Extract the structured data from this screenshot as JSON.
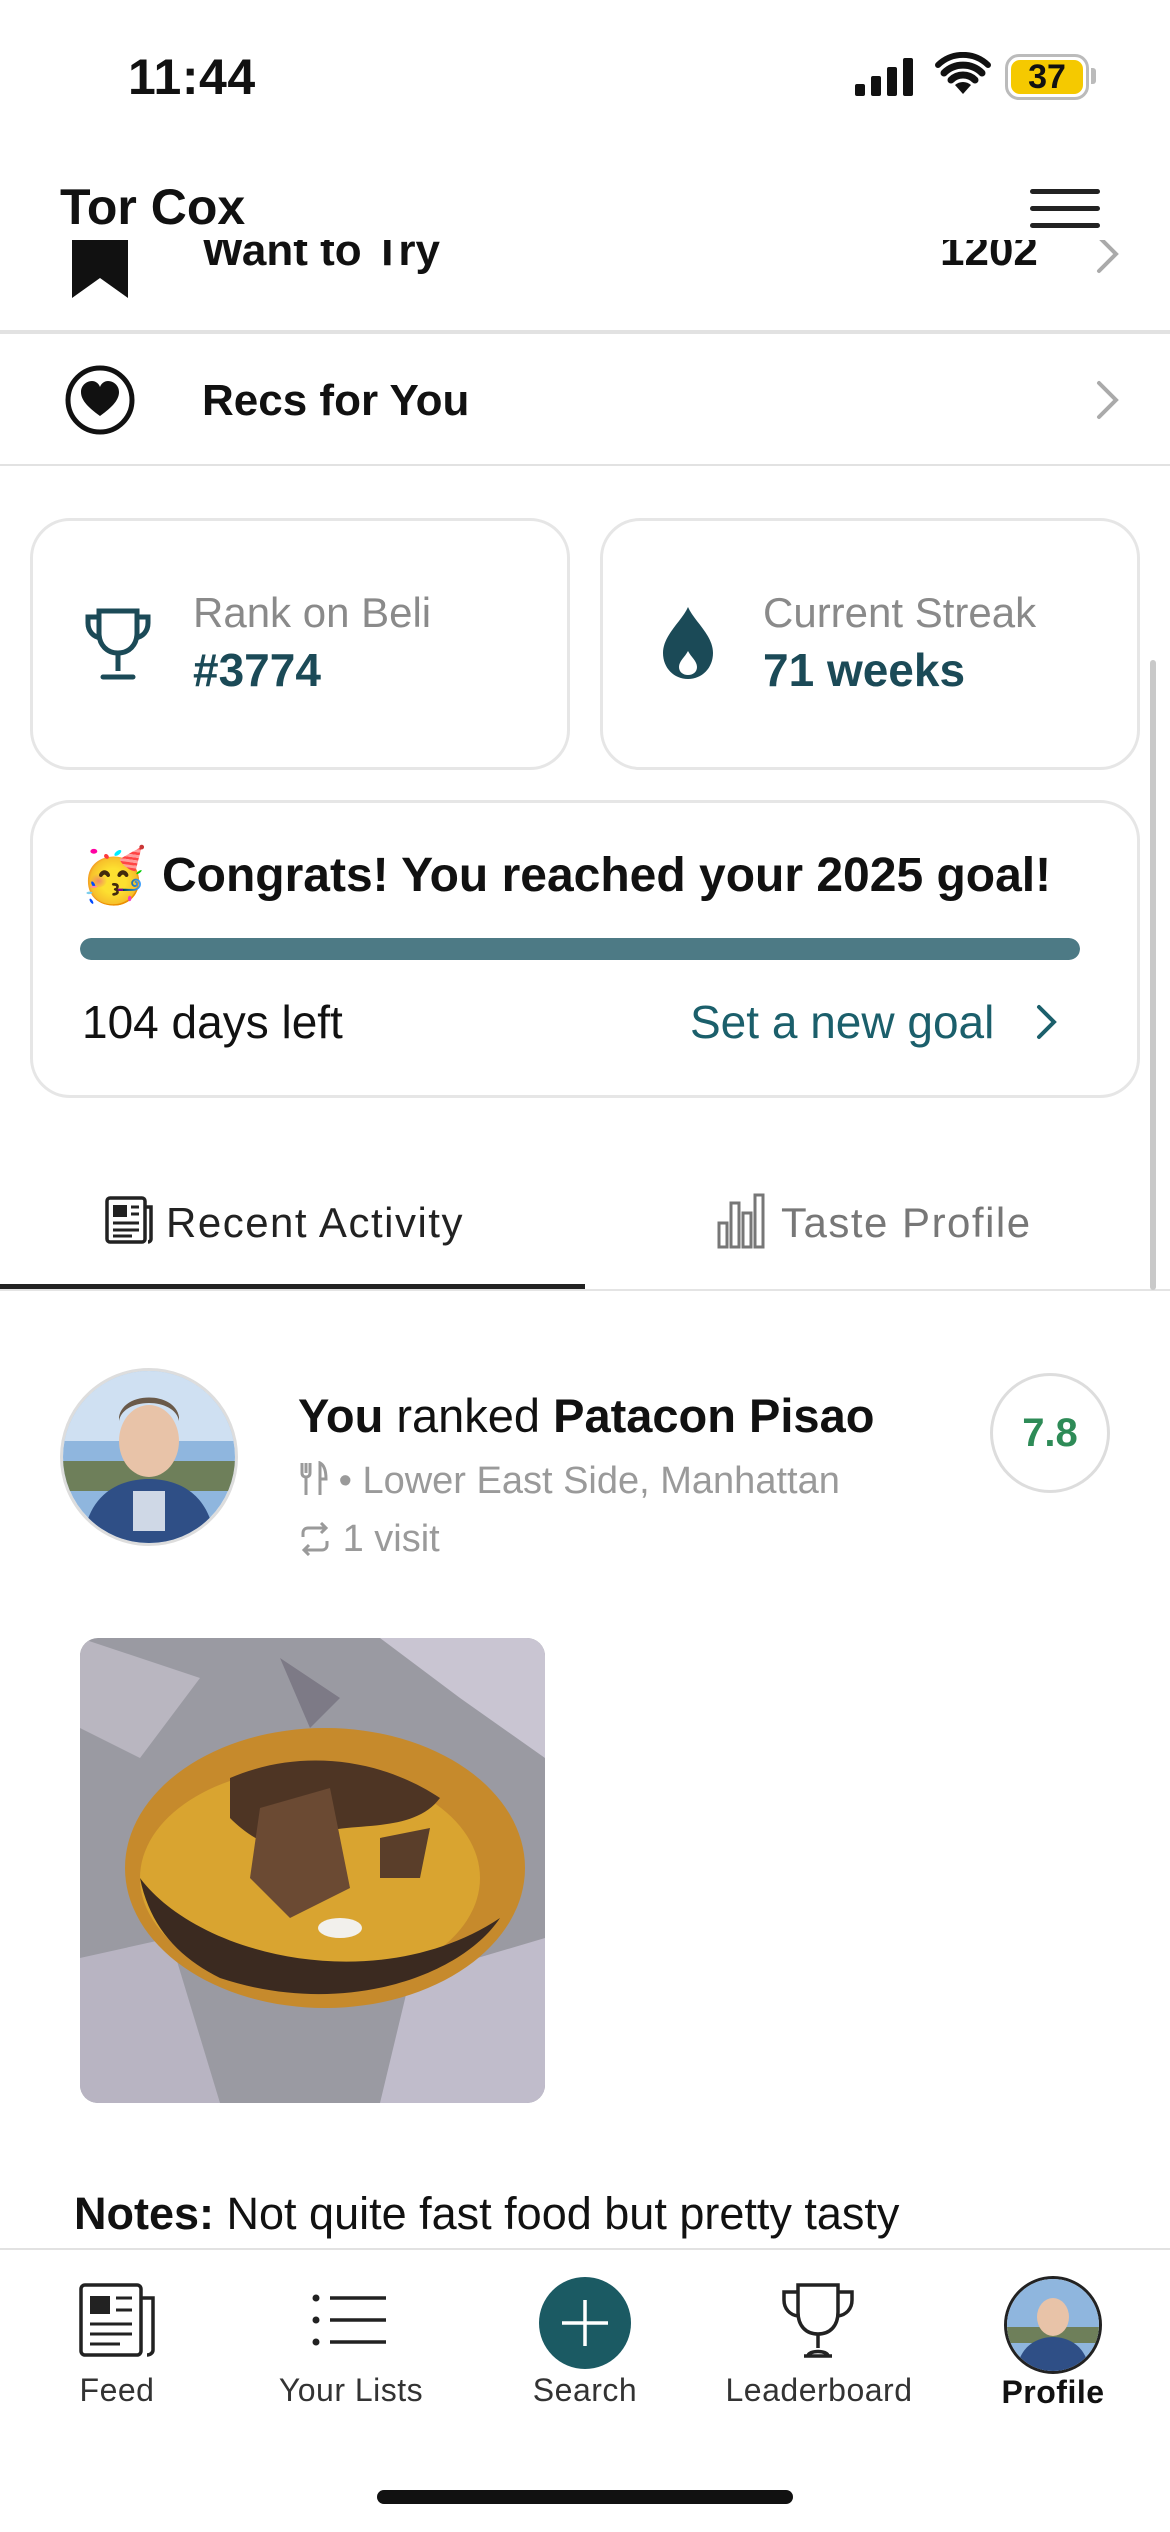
{
  "status_bar": {
    "time": "11:44",
    "battery": "37"
  },
  "header": {
    "title": "Tor Cox"
  },
  "list_rows": [
    {
      "label": "Want to Try",
      "count": "1202"
    },
    {
      "label": "Recs for You"
    }
  ],
  "stats": {
    "rank": {
      "label": "Rank on Beli",
      "value": "#3774"
    },
    "streak": {
      "label": "Current Streak",
      "value": "71 weeks"
    }
  },
  "goal": {
    "emoji": "🥳",
    "message": "Congrats! You reached your 2025 goal!",
    "progress": 1.0,
    "days_left": "104 days left",
    "cta": "Set a new goal"
  },
  "tabs": [
    {
      "label": "Recent Activity",
      "active": true
    },
    {
      "label": "Taste Profile",
      "active": false
    }
  ],
  "activity": {
    "subject": "You",
    "verb": "ranked",
    "restaurant": "Patacon Pisao",
    "location": "Lower East Side, Manhattan",
    "visits": "1 visit",
    "score": "7.8",
    "notes_label": "Notes:",
    "notes": "Not quite fast food but pretty tasty"
  },
  "tab_bar": [
    {
      "label": "Feed",
      "icon": "newspaper-icon"
    },
    {
      "label": "Your Lists",
      "icon": "list-icon"
    },
    {
      "label": "Search",
      "icon": "plus-icon"
    },
    {
      "label": "Leaderboard",
      "icon": "trophy-icon"
    },
    {
      "label": "Profile",
      "icon": "avatar"
    }
  ],
  "colors": {
    "accent": "#1b4a57",
    "teal": "#1b5f6b",
    "score": "#2e8b57",
    "progress": "#4d7a85"
  }
}
